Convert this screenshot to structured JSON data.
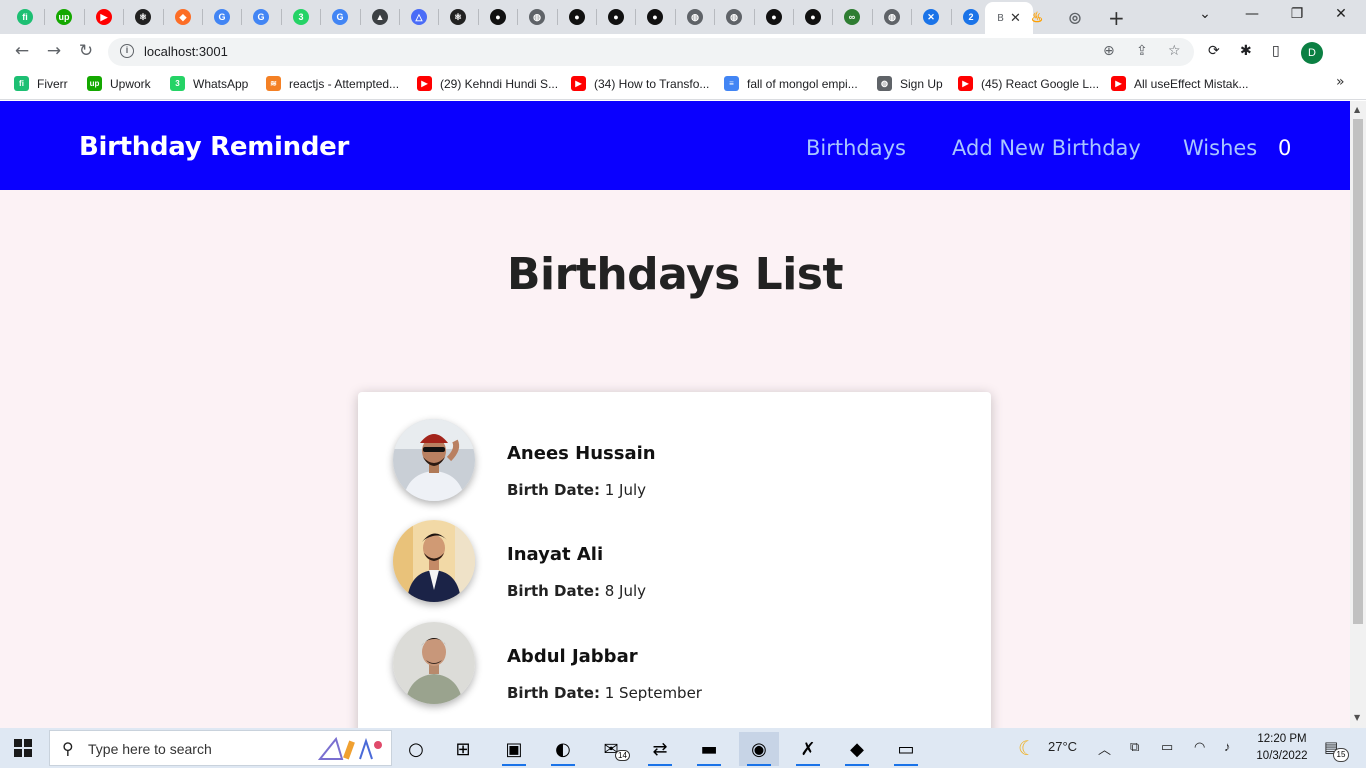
{
  "browser": {
    "tabs": [
      {
        "icon": "fiverr-icon",
        "glyph": "fi",
        "color": "#1dbf73"
      },
      {
        "icon": "upwork-icon",
        "glyph": "up",
        "color": "#14a800"
      },
      {
        "icon": "youtube-icon",
        "glyph": "▶",
        "color": "#ff0000"
      },
      {
        "icon": "react-icon",
        "glyph": "⚛",
        "color": "#222222"
      },
      {
        "icon": "gitlab-icon",
        "glyph": "◆",
        "color": "#fc6d26"
      },
      {
        "icon": "google-icon",
        "glyph": "G",
        "color": "#4285f4"
      },
      {
        "icon": "google-icon",
        "glyph": "G",
        "color": "#4285f4"
      },
      {
        "icon": "whatsapp-icon",
        "glyph": "3",
        "color": "#25d366"
      },
      {
        "icon": "google-icon",
        "glyph": "G",
        "color": "#4285f4"
      },
      {
        "icon": "graduation-cap-icon",
        "glyph": "▲",
        "color": "#3c4043"
      },
      {
        "icon": "vercel-icon",
        "glyph": "△",
        "color": "#4a6cf7"
      },
      {
        "icon": "react-icon",
        "glyph": "⚛",
        "color": "#222222"
      },
      {
        "icon": "github-icon",
        "glyph": "●",
        "color": "#111111"
      },
      {
        "icon": "globe-icon",
        "glyph": "◍",
        "color": "#5f6368"
      },
      {
        "icon": "github-icon",
        "glyph": "●",
        "color": "#111111"
      },
      {
        "icon": "github-icon",
        "glyph": "●",
        "color": "#111111"
      },
      {
        "icon": "github-icon",
        "glyph": "●",
        "color": "#111111"
      },
      {
        "icon": "globe-icon",
        "glyph": "◍",
        "color": "#5f6368"
      },
      {
        "icon": "globe-icon",
        "glyph": "◍",
        "color": "#5f6368"
      },
      {
        "icon": "github-icon",
        "glyph": "●",
        "color": "#111111"
      },
      {
        "icon": "github-icon",
        "glyph": "●",
        "color": "#111111"
      },
      {
        "icon": "infinity-icon",
        "glyph": "∞",
        "color": "#2e7d32"
      },
      {
        "icon": "globe-icon",
        "glyph": "◍",
        "color": "#5f6368"
      },
      {
        "icon": "extension-tab-icon",
        "glyph": "✕",
        "color": "#1a73e8"
      },
      {
        "icon": "number-two-icon",
        "glyph": "2",
        "color": "#1a73e8"
      }
    ],
    "active_tab": {
      "icon": "page-icon",
      "glyph": "B",
      "close": "✕"
    },
    "after_tabs": [
      {
        "icon": "firebase-icon",
        "glyph": "♨",
        "color": "#ffa000"
      },
      {
        "icon": "chrome-icon",
        "glyph": "◎",
        "color": "#5f6368"
      }
    ],
    "new_tab": "+",
    "window_controls": {
      "dropdown": "⌄",
      "minimize": "—",
      "restore": "❐",
      "close": "✕"
    },
    "nav": {
      "back": "←",
      "forward": "→",
      "reload": "↻"
    },
    "url": "localhost:3001",
    "omnibox_icons": {
      "zoom": "⊕",
      "share": "⇪",
      "star": "☆"
    },
    "extension_icons": {
      "sync": "⟳",
      "puzzle": "✱",
      "sidepanel": "▯"
    },
    "profile_letter": "D"
  },
  "bookmarks": [
    {
      "label": "Fiverr",
      "glyph": "fi",
      "color": "#1dbf73"
    },
    {
      "label": "Upwork",
      "glyph": "up",
      "color": "#14a800"
    },
    {
      "label": "WhatsApp",
      "glyph": "3",
      "color": "#25d366"
    },
    {
      "label": "reactjs - Attempted...",
      "glyph": "≋",
      "color": "#f48024"
    },
    {
      "label": "(29) Kehndi Hundi S...",
      "glyph": "▶",
      "color": "#ff0000"
    },
    {
      "label": "(34) How to Transfo...",
      "glyph": "▶",
      "color": "#ff0000"
    },
    {
      "label": "fall of mongol empi...",
      "glyph": "≡",
      "color": "#4285f4"
    },
    {
      "label": "Sign Up",
      "glyph": "◍",
      "color": "#5f6368"
    },
    {
      "label": "(45) React Google L...",
      "glyph": "▶",
      "color": "#ff0000"
    },
    {
      "label": "All useEffect Mistak...",
      "glyph": "▶",
      "color": "#ff0000"
    }
  ],
  "bookmarks_more": "»",
  "app": {
    "brand": "Birthday Reminder",
    "nav_links": [
      "Birthdays",
      "Add New Birthday",
      "Wishes"
    ],
    "wishes_count": "0",
    "page_title": "Birthdays List",
    "birthdays": [
      {
        "name": "Anees Hussain",
        "birth_label": "Birth Date:",
        "date": "1 July"
      },
      {
        "name": "Inayat Ali",
        "birth_label": "Birth Date:",
        "date": "8 July"
      },
      {
        "name": "Abdul Jabbar",
        "birth_label": "Birth Date:",
        "date": "1 September"
      }
    ]
  },
  "taskbar": {
    "search_placeholder": "Type here to search",
    "apps": [
      {
        "icon": "task-view-icon",
        "glyph": "○"
      },
      {
        "icon": "widgets-icon",
        "glyph": "⊞"
      },
      {
        "icon": "terminal-app-icon",
        "glyph": "▣"
      },
      {
        "icon": "edge-icon",
        "glyph": "◐"
      },
      {
        "icon": "mail-icon",
        "glyph": "✉"
      },
      {
        "icon": "teamviewer-icon",
        "glyph": "⇄"
      },
      {
        "icon": "file-explorer-icon",
        "glyph": "▬"
      },
      {
        "icon": "chrome-icon",
        "glyph": "◉"
      },
      {
        "icon": "vscode-icon",
        "glyph": "✗"
      },
      {
        "icon": "git-icon",
        "glyph": "◆"
      },
      {
        "icon": "cmd-icon",
        "glyph": "▭"
      }
    ],
    "mail_badge": "14",
    "weather": "27°C",
    "time": "12:20 PM",
    "date": "10/3/2022",
    "notifications": "15"
  }
}
